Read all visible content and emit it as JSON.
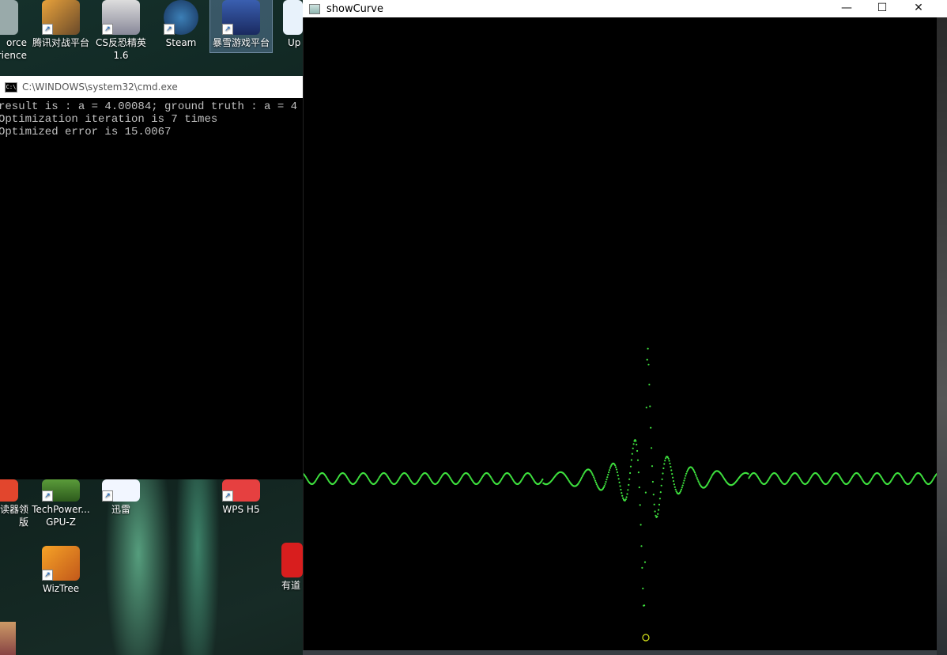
{
  "desktop": {
    "icons_top": [
      {
        "label": "orce\nrience"
      },
      {
        "label": "腾讯对战平台"
      },
      {
        "label": "CS反恐精英\n1.6"
      },
      {
        "label": "Steam"
      },
      {
        "label": "暴雪游戏平台"
      },
      {
        "label": "Up"
      }
    ],
    "icons_bottom": [
      {
        "label": "读器领\n版"
      },
      {
        "label": "TechPower...\nGPU-Z"
      },
      {
        "label": "迅雷"
      },
      {
        "label": "WPS H5"
      },
      {
        "label": "WizTree"
      },
      {
        "label": "有道"
      }
    ]
  },
  "cmd": {
    "title": "C:\\WINDOWS\\system32\\cmd.exe",
    "lines": [
      "result is : a = 4.00084; ground truth : a = 4",
      "Optimization iteration is 7 times",
      "Optimized error is 15.0067"
    ]
  },
  "plot_window": {
    "title": "showCurve",
    "minimize": "—",
    "maximize": "☐",
    "close": "✕",
    "curve_color": "#3fe23f",
    "marker_color": "#d9e61a"
  }
}
